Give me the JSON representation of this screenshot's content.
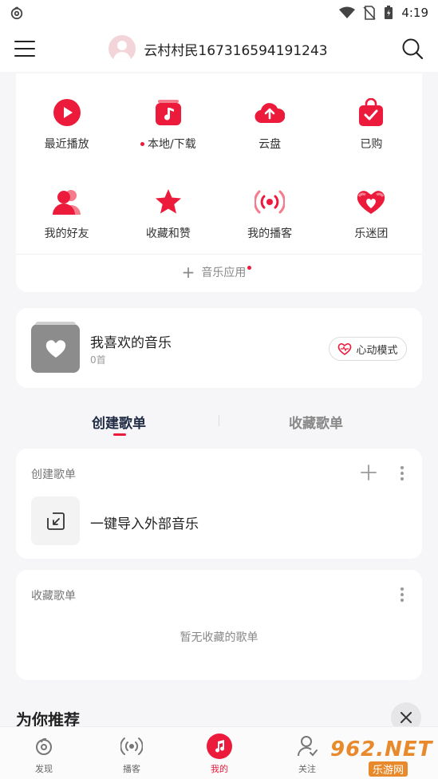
{
  "status_bar": {
    "time": "4:19",
    "icons": [
      "netease-cloud-icon",
      "wifi-icon",
      "no-sim-icon",
      "battery-icon"
    ]
  },
  "header": {
    "username": "云村村民167316594191243",
    "menu_icon": "hamburger-icon",
    "search_icon": "search-icon"
  },
  "quick_grid": {
    "row1": [
      {
        "label": "最近播放",
        "icon": "play-circle-icon",
        "dot": false
      },
      {
        "label": "本地/下载",
        "icon": "music-note-box-icon",
        "dot": true
      },
      {
        "label": "云盘",
        "icon": "cloud-upload-icon",
        "dot": false
      },
      {
        "label": "已购",
        "icon": "shopping-bag-check-icon",
        "dot": false
      }
    ],
    "row2": [
      {
        "label": "我的好友",
        "icon": "friends-icon",
        "dot": false
      },
      {
        "label": "收藏和赞",
        "icon": "star-icon",
        "dot": false
      },
      {
        "label": "我的播客",
        "icon": "broadcast-icon",
        "dot": false
      },
      {
        "label": "乐迷团",
        "icon": "heart-fan-icon",
        "dot": false
      }
    ],
    "music_app_label": "音乐应用"
  },
  "favorite": {
    "title": "我喜欢的音乐",
    "count": "0首",
    "heart_mode_label": "心动模式"
  },
  "tabs": {
    "created": "创建歌单",
    "collected": "收藏歌单",
    "active": "created"
  },
  "created_section": {
    "title": "创建歌单",
    "import_label": "一键导入外部音乐"
  },
  "collected_section": {
    "title": "收藏歌单",
    "empty_text": "暂无收藏的歌单"
  },
  "recommend": {
    "title": "为你推荐"
  },
  "bottom_nav": {
    "items": [
      {
        "label": "发现",
        "icon": "netease-logo-icon"
      },
      {
        "label": "播客",
        "icon": "podcast-icon"
      },
      {
        "label": "我的",
        "icon": "music-note-icon"
      },
      {
        "label": "关注",
        "icon": "follow-user-icon"
      }
    ],
    "active_index": 2
  },
  "watermark": {
    "text": "962.NET",
    "sub": "乐游网"
  },
  "colors": {
    "accent": "#ec1b3c",
    "background": "#f6f6f8"
  }
}
